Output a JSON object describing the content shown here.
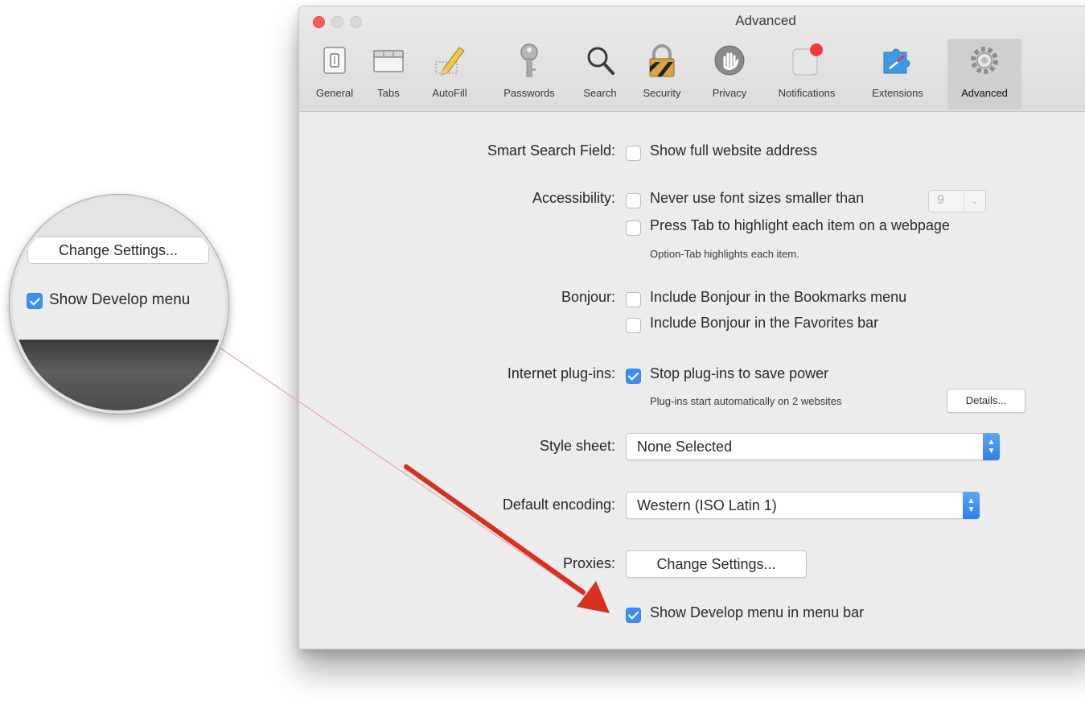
{
  "window": {
    "title": "Advanced",
    "toolbar": [
      {
        "label": "General",
        "icon": "general-switch-icon"
      },
      {
        "label": "Tabs",
        "icon": "tabs-icon"
      },
      {
        "label": "AutoFill",
        "icon": "autofill-pencil-icon"
      },
      {
        "label": "Passwords",
        "icon": "key-icon"
      },
      {
        "label": "Search",
        "icon": "magnifying-glass-icon"
      },
      {
        "label": "Security",
        "icon": "padlock-icon"
      },
      {
        "label": "Privacy",
        "icon": "hand-icon"
      },
      {
        "label": "Notifications",
        "icon": "notification-badge-icon"
      },
      {
        "label": "Extensions",
        "icon": "puzzle-compass-icon"
      },
      {
        "label": "Advanced",
        "icon": "gears-icon",
        "selected": true
      }
    ]
  },
  "settings": {
    "smart_search": {
      "label": "Smart Search Field:",
      "option": "Show full website address",
      "checked": false
    },
    "accessibility": {
      "label": "Accessibility:",
      "font_option": "Never use font sizes smaller than",
      "font_size": "9",
      "font_checked": false,
      "tab_option": "Press Tab to highlight each item on a webpage",
      "tab_checked": false,
      "tab_note": "Option-Tab highlights each item."
    },
    "bonjour": {
      "label": "Bonjour:",
      "bookmarks_option": "Include Bonjour in the Bookmarks menu",
      "bookmarks_checked": false,
      "favorites_option": "Include Bonjour in the Favorites bar",
      "favorites_checked": false
    },
    "plugins": {
      "label": "Internet plug-ins:",
      "option": "Stop plug-ins to save power",
      "checked": true,
      "note": "Plug-ins start automatically on 2 websites",
      "details_button": "Details..."
    },
    "style_sheet": {
      "label": "Style sheet:",
      "value": "None Selected"
    },
    "encoding": {
      "label": "Default encoding:",
      "value": "Western (ISO Latin 1)"
    },
    "proxies": {
      "label": "Proxies:",
      "button": "Change Settings..."
    },
    "develop": {
      "option": "Show Develop menu in menu bar",
      "checked": true
    }
  },
  "magnifier": {
    "button": "Change Settings...",
    "option": "Show Develop menu",
    "checked": true
  },
  "colors": {
    "accent_blue": "#3e8ef0",
    "arrow_red": "#d7301f",
    "close_red": "#fc5f57"
  }
}
